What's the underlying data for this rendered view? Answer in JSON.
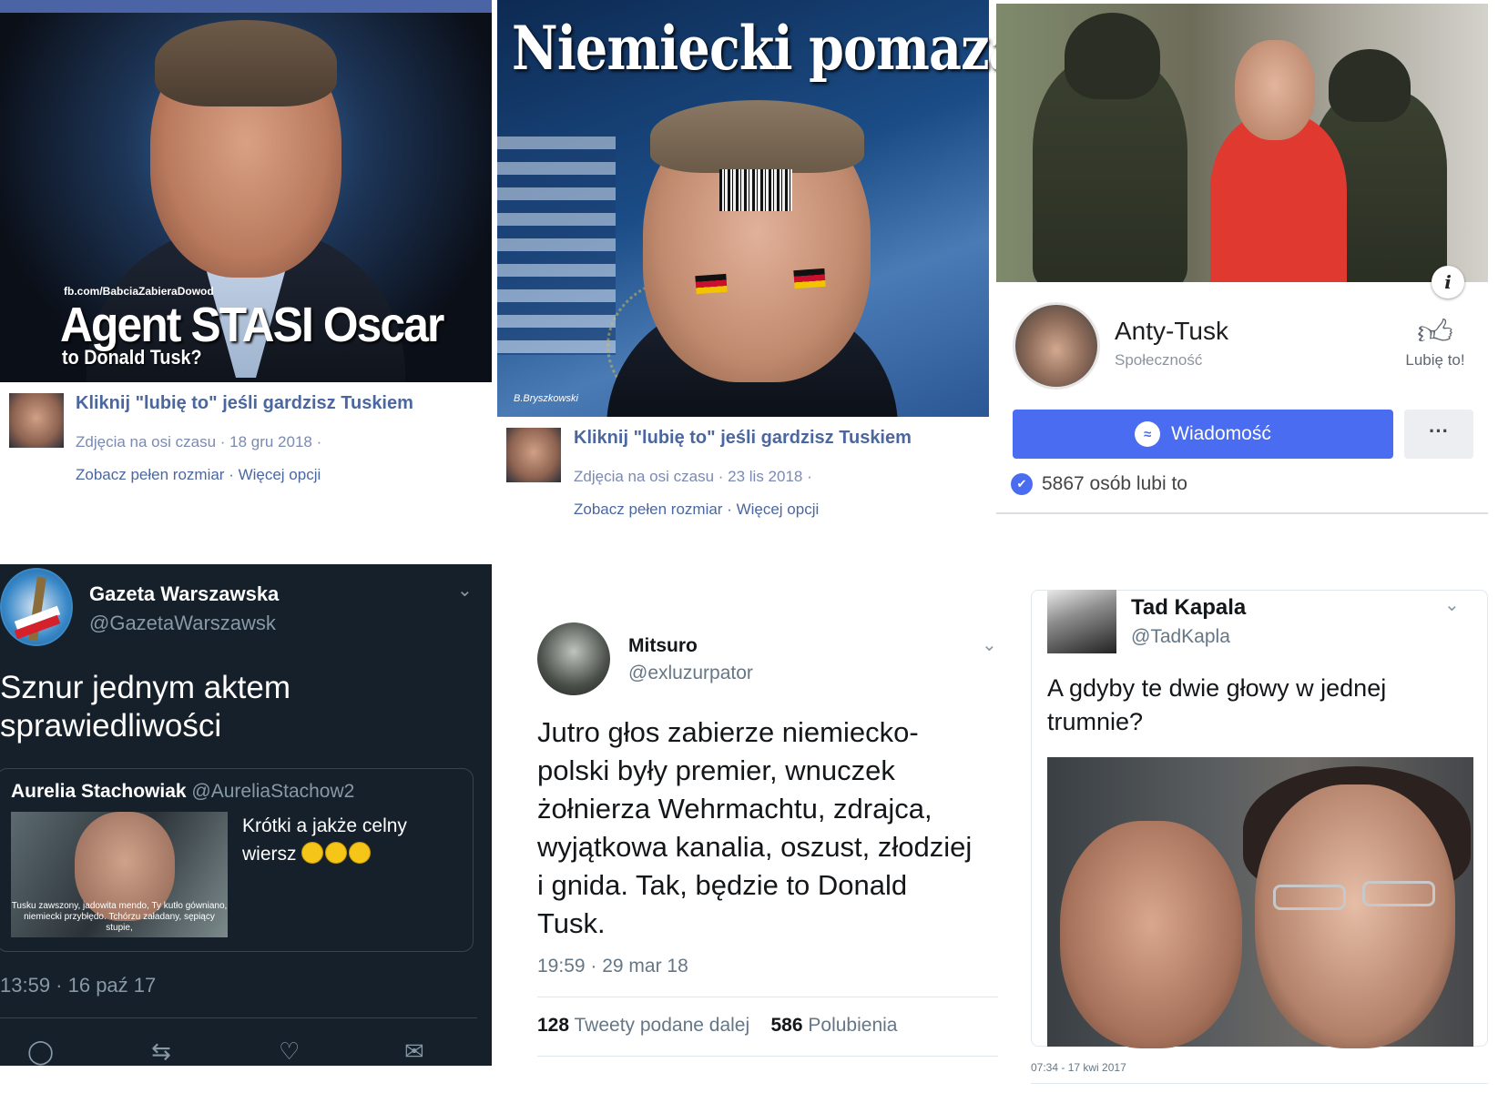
{
  "panel1": {
    "image_watermark": "fb.com/BabciaZabieraDowod",
    "image_headline": "Agent STASI Oscar",
    "image_subline": "to Donald Tusk?",
    "post_title": "Kliknij \"lubię to\" jeśli gardzisz Tuskiem",
    "meta": "Zdjęcia na osi czasu · 18 gru 2018 ·",
    "link_full": "Zobacz pełen rozmiar",
    "link_sep": " · ",
    "link_more": "Więcej opcji"
  },
  "panel2": {
    "image_headline": "Niemiecki pomazaniec",
    "image_signature": "B.Bryszkowski",
    "post_title": "Kliknij \"lubię to\" jeśli gardzisz Tuskiem",
    "meta": "Zdjęcia na osi czasu · 23 lis 2018 ·",
    "link_full": "Zobacz pełen rozmiar",
    "link_sep": " · ",
    "link_more": "Więcej opcji"
  },
  "panel3": {
    "info_glyph": "i",
    "page_name": "Anty-Tusk",
    "page_category": "Społeczność",
    "like_label": "Lubię to!",
    "message_label": "Wiadomość",
    "more_label": "···",
    "likes_text": "5867 osób lubi to"
  },
  "panel4": {
    "name": "Gazeta Warszawska",
    "handle": "@GazetaWarszawsk",
    "text": "Sznur jednym aktem sprawiedliwości",
    "quote_name": "Aurelia Stachowiak",
    "quote_handle": "@AureliaStachow2",
    "quote_text": "Krótki a jakże celny wiersz",
    "quote_image_caption": "Tusku zawszony, jadowita mendo, Ty kutło gówniano, niemiecki przybłędo. Tchórzu załadany, sępiący stupie,",
    "time": "13:59 · 16 paź 17"
  },
  "panel5": {
    "name": "Mitsuro",
    "handle": "@exluzurpator",
    "text": "Jutro głos zabierze niemiecko-polski były premier, wnuczek żołnierza Wehrmachtu, zdrajca, wyjątkowa kanalia, oszust, złodziej i gnida. Tak, będzie to Donald Tusk.",
    "time": "19:59 · 29 mar 18",
    "retweets_count": "128",
    "retweets_label": "Tweety podane dalej",
    "likes_count": "586",
    "likes_label": "Polubienia"
  },
  "panel6": {
    "name": "Tad Kapala",
    "handle": "@TadKapla",
    "text": "A gdyby te dwie głowy w jednej trumnie?",
    "time": "07:34 - 17 kwi 2017"
  },
  "icons": {
    "chevron": "⌄",
    "reply": "○",
    "retweet": "⇄",
    "heart": "♡",
    "mail": "✉",
    "thumb": "👍",
    "messenger": "⚡"
  },
  "colors": {
    "fb_blue": "#4a6cf0",
    "fb_link": "#4b67a0",
    "twitter_dark_bg": "#15202b",
    "twitter_gray": "#657786"
  }
}
